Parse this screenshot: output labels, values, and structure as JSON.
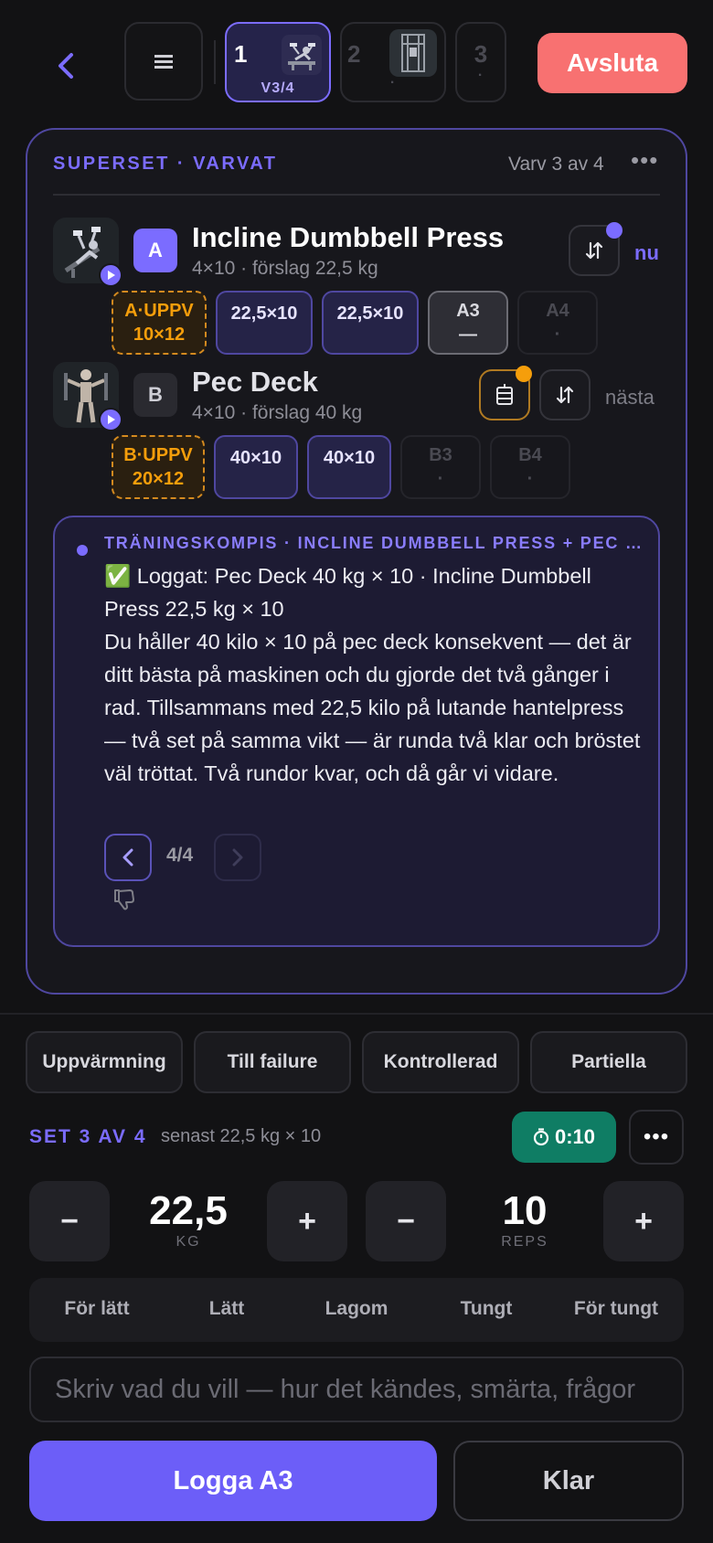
{
  "header": {
    "tabs": [
      {
        "num": "1",
        "sub": "V3/4"
      },
      {
        "num": "2",
        "sub": "·"
      },
      {
        "num": "3",
        "sub": "·"
      }
    ],
    "end_label": "Avsluta"
  },
  "superset": {
    "title": "SUPERSET · VARVAT",
    "round": "Varv 3 av 4",
    "more": "•••",
    "exercises": [
      {
        "letter": "A",
        "name": "Incline Dumbbell Press",
        "sub": "4×10 · förslag 22,5 kg",
        "state": "nu",
        "chips": [
          {
            "top": "A·UPPV",
            "bottom": "10×12",
            "kind": "warm"
          },
          {
            "top": "22,5×10",
            "bottom": "",
            "kind": "done"
          },
          {
            "top": "22,5×10",
            "bottom": "",
            "kind": "done"
          },
          {
            "top": "A3",
            "bottom": "—",
            "kind": "current"
          },
          {
            "top": "A4",
            "bottom": "·",
            "kind": "future"
          }
        ]
      },
      {
        "letter": "B",
        "name": "Pec Deck",
        "sub": "4×10 · förslag 40 kg",
        "state": "nästa",
        "chips": [
          {
            "top": "B·UPPV",
            "bottom": "20×12",
            "kind": "warm"
          },
          {
            "top": "40×10",
            "bottom": "",
            "kind": "done"
          },
          {
            "top": "40×10",
            "bottom": "",
            "kind": "done"
          },
          {
            "top": "B3",
            "bottom": "·",
            "kind": "future"
          },
          {
            "top": "B4",
            "bottom": "·",
            "kind": "future"
          }
        ]
      }
    ]
  },
  "coach": {
    "header": "TRÄNINGSKOMPIS · INCLINE DUMBBELL PRESS + PEC DECK",
    "logged": "✅ Loggat: Pec Deck 40 kg × 10 · Incline Dumbbell Press 22,5 kg × 10",
    "message": "Du håller 40 kilo × 10 på pec deck konsekvent — det är ditt bästa på maskinen och du gjorde det två gånger i rad. Tillsammans med 22,5 kilo på lutande hantelpress — två set på samma vikt — är runda två klar och bröstet väl tröttat. Två rundor kvar, och då går vi vidare.",
    "pager": "4/4"
  },
  "tags": [
    "Uppvärmning",
    "Till failure",
    "Kontrollerad",
    "Partiella"
  ],
  "set": {
    "label": "SET 3 AV 4",
    "last": "senast 22,5 kg × 10",
    "timer": "0:10",
    "more": "•••",
    "weight": "22,5",
    "weight_unit": "KG",
    "reps": "10",
    "reps_unit": "REPS",
    "minus": "−",
    "plus": "+"
  },
  "rpe": [
    "För lätt",
    "Lätt",
    "Lagom",
    "Tungt",
    "För tungt"
  ],
  "note": {
    "placeholder": "Skriv vad du vill — hur det kändes, smärta, frågor"
  },
  "actions": {
    "log": "Logga A3",
    "done": "Klar"
  },
  "colors": {
    "accent": "#7b6cff",
    "danger": "#f87171",
    "warm": "#f59e0b",
    "timer": "#0f7d64"
  }
}
